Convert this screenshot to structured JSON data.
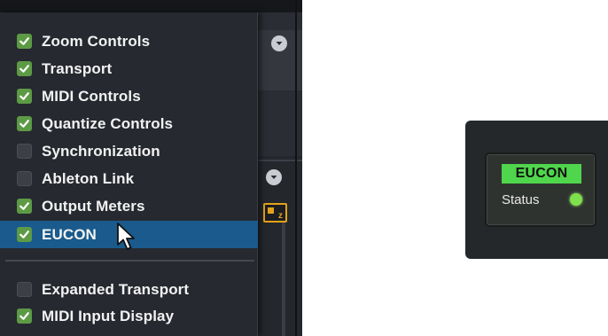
{
  "menu": {
    "items": [
      {
        "label": "Zoom Controls",
        "checked": true
      },
      {
        "label": "Transport",
        "checked": true
      },
      {
        "label": "MIDI Controls",
        "checked": true
      },
      {
        "label": "Quantize Controls",
        "checked": true
      },
      {
        "label": "Synchronization",
        "checked": false
      },
      {
        "label": "Ableton Link",
        "checked": false
      },
      {
        "label": "Output Meters",
        "checked": true
      },
      {
        "label": "EUCON",
        "checked": true,
        "selected": true
      },
      {
        "label": "Expanded Transport",
        "checked": false
      },
      {
        "label": "MIDI Input Display",
        "checked": true
      }
    ]
  },
  "status_panel": {
    "badge_label": "EUCON",
    "status_label": "Status",
    "status_color": "#7ee04a"
  },
  "colors": {
    "checked": "#5d9a45",
    "selection": "#1a5a8c",
    "badge": "#4fd64c",
    "meter_accent": "#e3a21a"
  },
  "icons": [
    "checkbox-checked-icon",
    "checkbox-empty-icon",
    "chevron-down-icon",
    "meter-icon",
    "mouse-pointer-icon",
    "status-led-icon"
  ]
}
